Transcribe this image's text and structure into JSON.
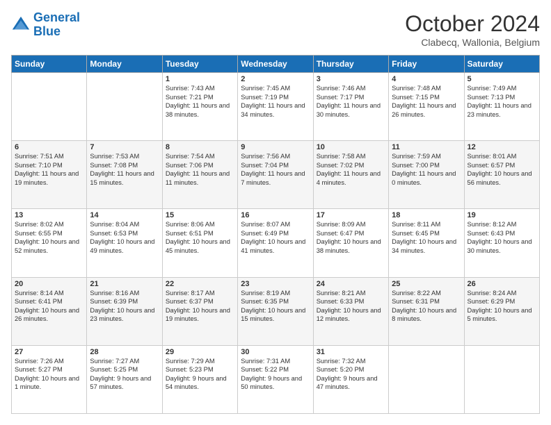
{
  "logo": {
    "line1": "General",
    "line2": "Blue"
  },
  "header": {
    "month": "October 2024",
    "location": "Clabecq, Wallonia, Belgium"
  },
  "weekdays": [
    "Sunday",
    "Monday",
    "Tuesday",
    "Wednesday",
    "Thursday",
    "Friday",
    "Saturday"
  ],
  "weeks": [
    [
      {
        "day": "",
        "info": ""
      },
      {
        "day": "",
        "info": ""
      },
      {
        "day": "1",
        "info": "Sunrise: 7:43 AM\nSunset: 7:21 PM\nDaylight: 11 hours\nand 38 minutes."
      },
      {
        "day": "2",
        "info": "Sunrise: 7:45 AM\nSunset: 7:19 PM\nDaylight: 11 hours\nand 34 minutes."
      },
      {
        "day": "3",
        "info": "Sunrise: 7:46 AM\nSunset: 7:17 PM\nDaylight: 11 hours\nand 30 minutes."
      },
      {
        "day": "4",
        "info": "Sunrise: 7:48 AM\nSunset: 7:15 PM\nDaylight: 11 hours\nand 26 minutes."
      },
      {
        "day": "5",
        "info": "Sunrise: 7:49 AM\nSunset: 7:13 PM\nDaylight: 11 hours\nand 23 minutes."
      }
    ],
    [
      {
        "day": "6",
        "info": "Sunrise: 7:51 AM\nSunset: 7:10 PM\nDaylight: 11 hours\nand 19 minutes."
      },
      {
        "day": "7",
        "info": "Sunrise: 7:53 AM\nSunset: 7:08 PM\nDaylight: 11 hours\nand 15 minutes."
      },
      {
        "day": "8",
        "info": "Sunrise: 7:54 AM\nSunset: 7:06 PM\nDaylight: 11 hours\nand 11 minutes."
      },
      {
        "day": "9",
        "info": "Sunrise: 7:56 AM\nSunset: 7:04 PM\nDaylight: 11 hours\nand 7 minutes."
      },
      {
        "day": "10",
        "info": "Sunrise: 7:58 AM\nSunset: 7:02 PM\nDaylight: 11 hours\nand 4 minutes."
      },
      {
        "day": "11",
        "info": "Sunrise: 7:59 AM\nSunset: 7:00 PM\nDaylight: 11 hours\nand 0 minutes."
      },
      {
        "day": "12",
        "info": "Sunrise: 8:01 AM\nSunset: 6:57 PM\nDaylight: 10 hours\nand 56 minutes."
      }
    ],
    [
      {
        "day": "13",
        "info": "Sunrise: 8:02 AM\nSunset: 6:55 PM\nDaylight: 10 hours\nand 52 minutes."
      },
      {
        "day": "14",
        "info": "Sunrise: 8:04 AM\nSunset: 6:53 PM\nDaylight: 10 hours\nand 49 minutes."
      },
      {
        "day": "15",
        "info": "Sunrise: 8:06 AM\nSunset: 6:51 PM\nDaylight: 10 hours\nand 45 minutes."
      },
      {
        "day": "16",
        "info": "Sunrise: 8:07 AM\nSunset: 6:49 PM\nDaylight: 10 hours\nand 41 minutes."
      },
      {
        "day": "17",
        "info": "Sunrise: 8:09 AM\nSunset: 6:47 PM\nDaylight: 10 hours\nand 38 minutes."
      },
      {
        "day": "18",
        "info": "Sunrise: 8:11 AM\nSunset: 6:45 PM\nDaylight: 10 hours\nand 34 minutes."
      },
      {
        "day": "19",
        "info": "Sunrise: 8:12 AM\nSunset: 6:43 PM\nDaylight: 10 hours\nand 30 minutes."
      }
    ],
    [
      {
        "day": "20",
        "info": "Sunrise: 8:14 AM\nSunset: 6:41 PM\nDaylight: 10 hours\nand 26 minutes."
      },
      {
        "day": "21",
        "info": "Sunrise: 8:16 AM\nSunset: 6:39 PM\nDaylight: 10 hours\nand 23 minutes."
      },
      {
        "day": "22",
        "info": "Sunrise: 8:17 AM\nSunset: 6:37 PM\nDaylight: 10 hours\nand 19 minutes."
      },
      {
        "day": "23",
        "info": "Sunrise: 8:19 AM\nSunset: 6:35 PM\nDaylight: 10 hours\nand 15 minutes."
      },
      {
        "day": "24",
        "info": "Sunrise: 8:21 AM\nSunset: 6:33 PM\nDaylight: 10 hours\nand 12 minutes."
      },
      {
        "day": "25",
        "info": "Sunrise: 8:22 AM\nSunset: 6:31 PM\nDaylight: 10 hours\nand 8 minutes."
      },
      {
        "day": "26",
        "info": "Sunrise: 8:24 AM\nSunset: 6:29 PM\nDaylight: 10 hours\nand 5 minutes."
      }
    ],
    [
      {
        "day": "27",
        "info": "Sunrise: 7:26 AM\nSunset: 5:27 PM\nDaylight: 10 hours\nand 1 minute."
      },
      {
        "day": "28",
        "info": "Sunrise: 7:27 AM\nSunset: 5:25 PM\nDaylight: 9 hours\nand 57 minutes."
      },
      {
        "day": "29",
        "info": "Sunrise: 7:29 AM\nSunset: 5:23 PM\nDaylight: 9 hours\nand 54 minutes."
      },
      {
        "day": "30",
        "info": "Sunrise: 7:31 AM\nSunset: 5:22 PM\nDaylight: 9 hours\nand 50 minutes."
      },
      {
        "day": "31",
        "info": "Sunrise: 7:32 AM\nSunset: 5:20 PM\nDaylight: 9 hours\nand 47 minutes."
      },
      {
        "day": "",
        "info": ""
      },
      {
        "day": "",
        "info": ""
      }
    ]
  ]
}
